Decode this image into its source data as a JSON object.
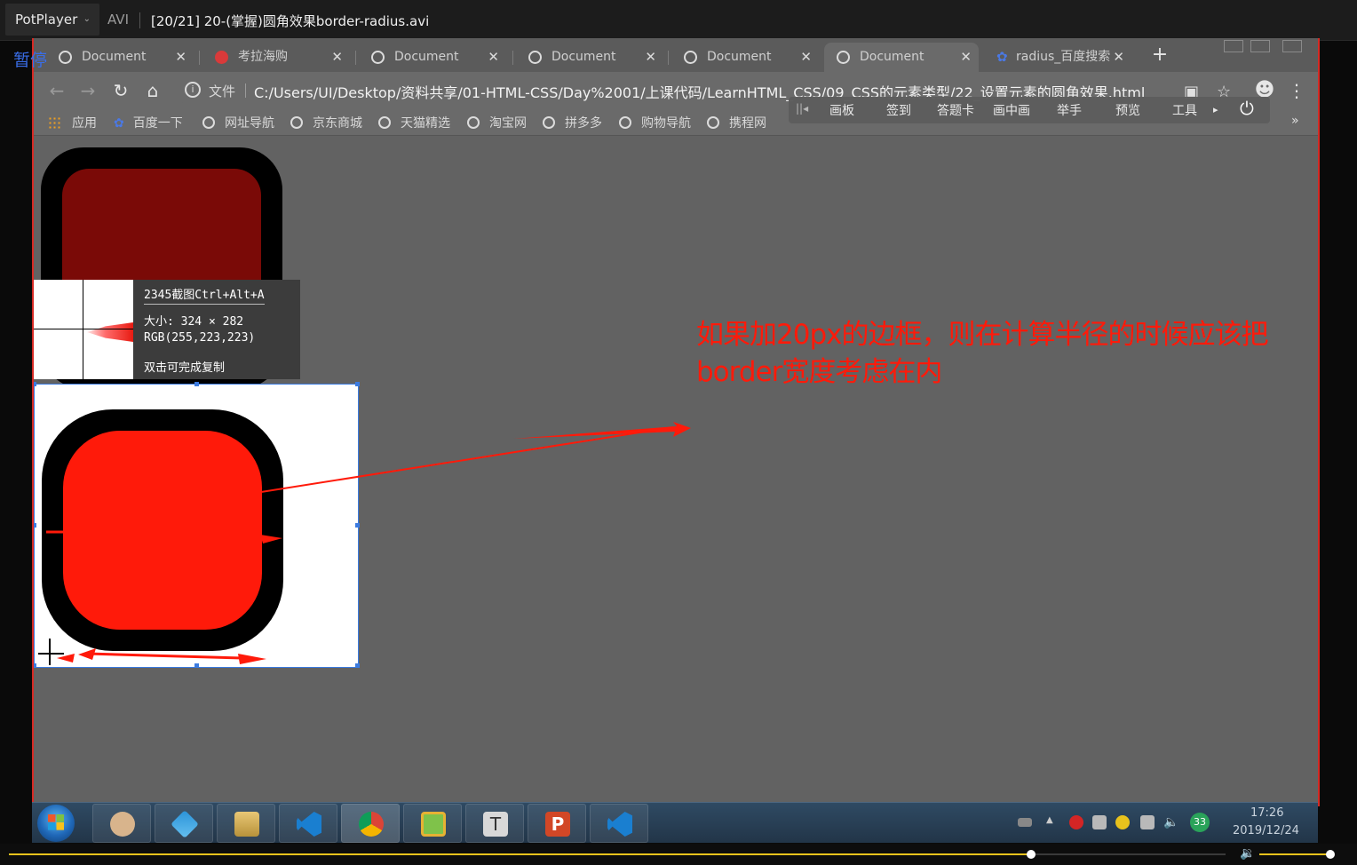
{
  "player": {
    "brand": "PotPlayer",
    "format": "AVI",
    "file_title": "[20/21] 20-(掌握)圆角效果border-radius.avi",
    "pause_label": "暂停",
    "progress": 0.84,
    "volume": 1.0
  },
  "browser": {
    "tabs": [
      {
        "label": "Document",
        "icon": "globe-icon"
      },
      {
        "label": "考拉海购",
        "icon": "kaola-icon"
      },
      {
        "label": "Document",
        "icon": "globe-icon"
      },
      {
        "label": "Document",
        "icon": "globe-icon"
      },
      {
        "label": "Document",
        "icon": "globe-icon"
      },
      {
        "label": "Document",
        "icon": "globe-icon",
        "active": true
      },
      {
        "label": "radius_百度搜索",
        "icon": "baidu-paw-icon"
      }
    ],
    "address": {
      "scheme_label": "文件",
      "url": "C:/Users/UI/Desktop/资料共享/01-HTML-CSS/Day%2001/上课代码/LearnHTML_CSS/09_CSS的元素类型/22_设置元素的圆角效果.html"
    },
    "bookmarks": [
      "应用",
      "百度一下",
      "网址导航",
      "京东商城",
      "天猫精选",
      "淘宝网",
      "拼多多",
      "购物导航",
      "携程网"
    ],
    "overlay_toolbar": [
      "画板",
      "签到",
      "答题卡",
      "画中画",
      "举手",
      "预览",
      "工具"
    ]
  },
  "snip_tool": {
    "title": "2345截图Ctrl+Alt+A",
    "size": "大小: 324 × 282",
    "rgb": "RGB(255,223,223)",
    "hint": "双击可完成复制"
  },
  "annotation": {
    "line1": "如果加20px的边框，则在计算半径的时候应该把",
    "line2": "border宽度考虑在内",
    "color": "#ff1a0a"
  },
  "taskbar": {
    "apps": [
      "user-avatar-app",
      "kk-app",
      "file-explorer-app",
      "vscode-app",
      "chrome-app",
      "notepad-app",
      "typora-app",
      "powerpoint-app",
      "vscode-app-2"
    ],
    "tray_badge": "33",
    "time": "17:26",
    "date": "2019/12/24"
  }
}
